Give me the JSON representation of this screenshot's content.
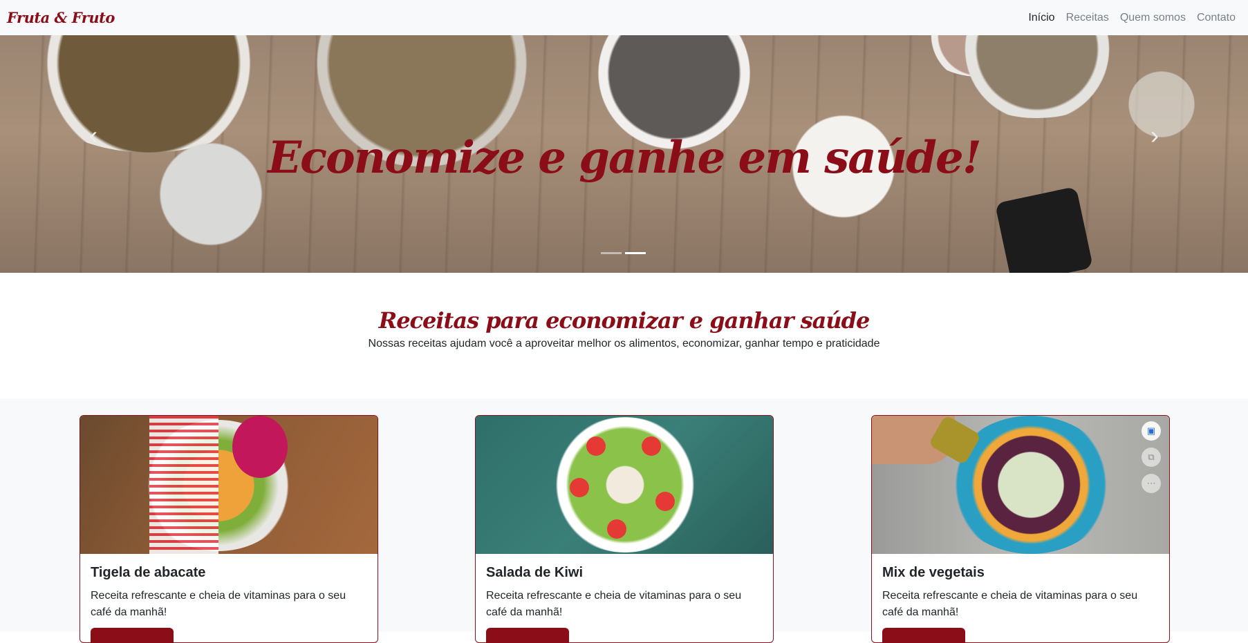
{
  "navbar": {
    "brand": "Fruta & Fruto",
    "links": [
      {
        "label": "Início"
      },
      {
        "label": "Receitas"
      },
      {
        "label": "Quem somos"
      },
      {
        "label": "Contato"
      }
    ]
  },
  "hero": {
    "caption": "Economize e ganhe em saúde!",
    "prev_icon": "chevron-left-icon",
    "next_icon": "chevron-right-icon",
    "active_slide": 2,
    "slide_count": 2
  },
  "intro": {
    "title": "Receitas para economizar e ganhar saúde",
    "subtitle": "Nossas receitas ajudam você a aproveitar melhor os alimentos, economizar, ganhar tempo e praticidade"
  },
  "cards": [
    {
      "title": "Tigela de abacate",
      "text": "Receita refrescante e cheia de vitaminas para o seu café da manhã!"
    },
    {
      "title": "Salada de Kiwi",
      "text": "Receita refrescante e cheia de vitaminas para o seu café da manhã!"
    },
    {
      "title": "Mix de vegetais",
      "text": "Receita refrescante e cheia de vitaminas para o seu café da manhã!"
    }
  ],
  "colors": {
    "brand": "#8b0d17",
    "navbar_bg": "#f8f9fa"
  },
  "image_tools": [
    "visual-search-icon",
    "copy-image-icon",
    "more-icon"
  ]
}
